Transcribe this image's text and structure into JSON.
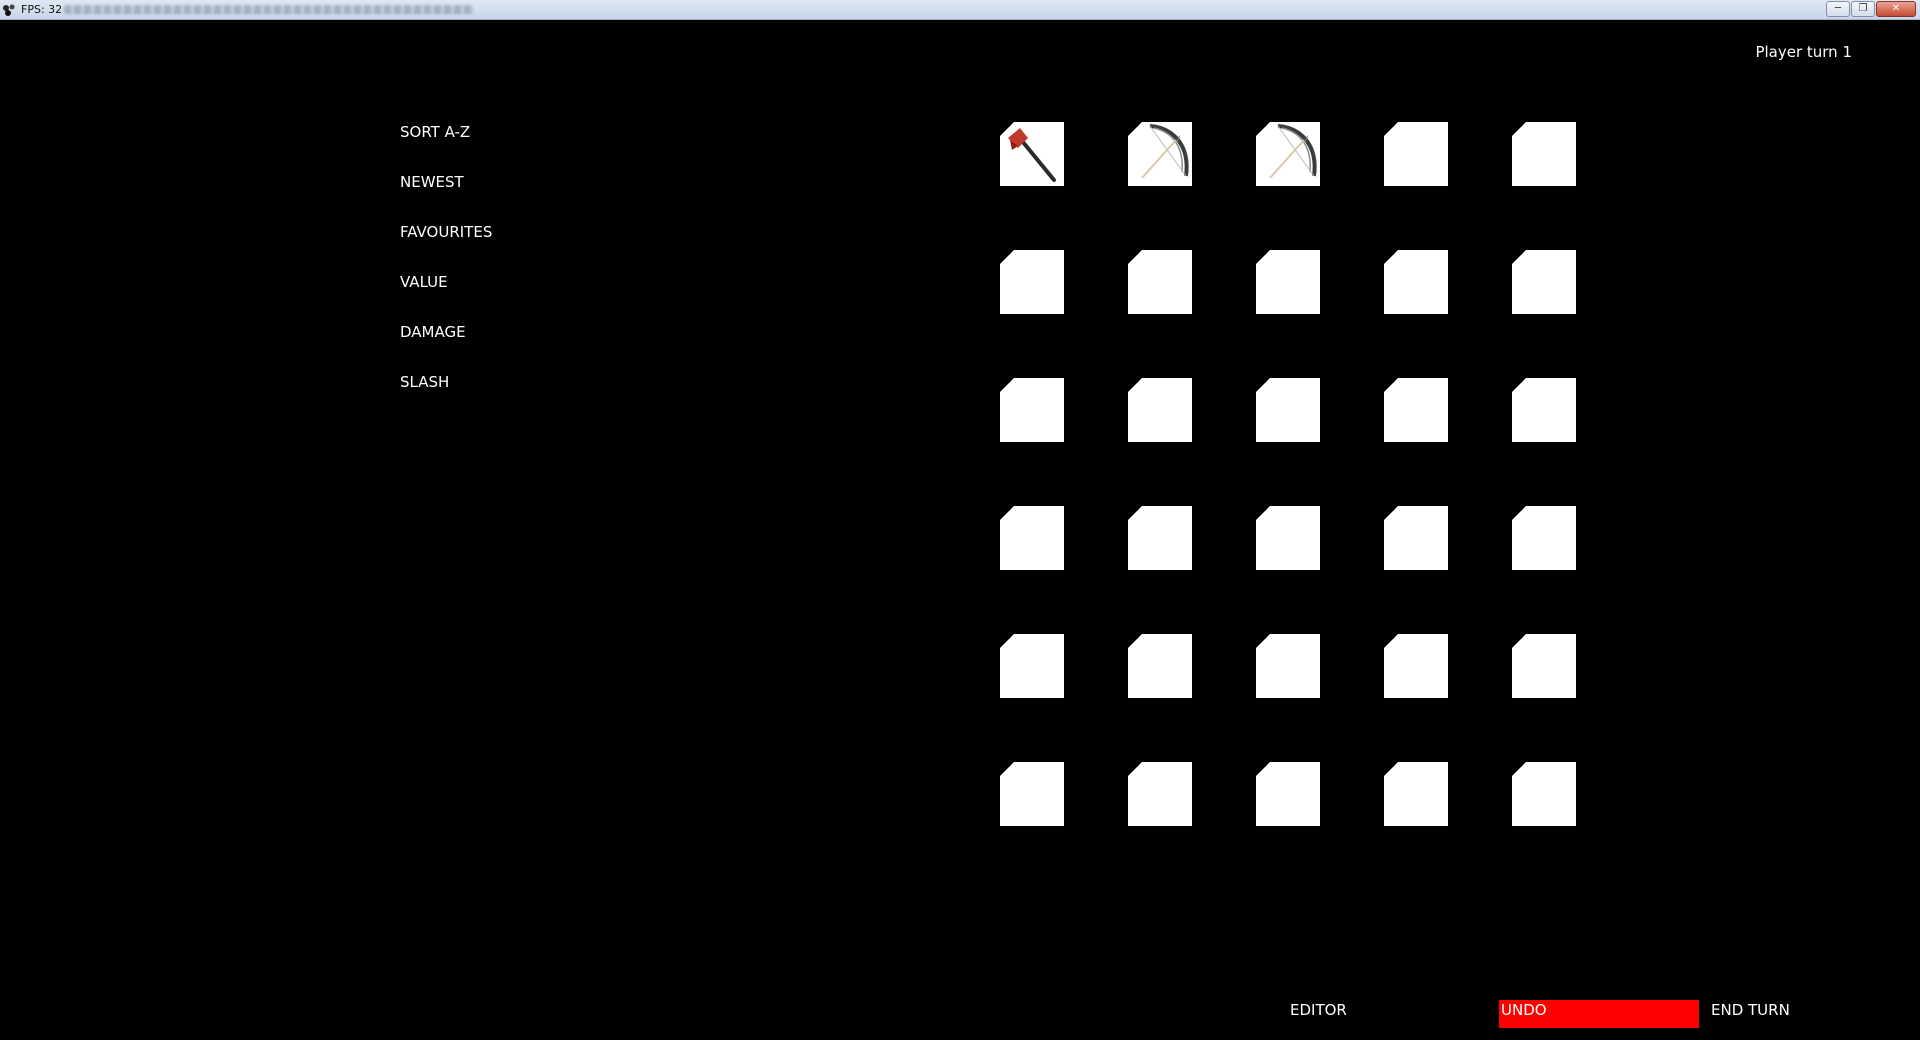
{
  "window": {
    "title": "FPS: 32",
    "controls": [
      "minimize",
      "maximize",
      "close"
    ]
  },
  "hud": {
    "player_turn": "Player turn 1"
  },
  "sort_menu": {
    "items": [
      "SORT A-Z",
      "NEWEST",
      "FAVOURITES",
      "VALUE",
      "DAMAGE",
      "SLASH"
    ]
  },
  "inventory": {
    "rows": 6,
    "columns": 5,
    "slots": [
      {
        "item": "axe-icon"
      },
      {
        "item": "bow-icon"
      },
      {
        "item": "bow-icon"
      },
      {
        "item": ""
      },
      {
        "item": ""
      },
      {
        "item": ""
      },
      {
        "item": ""
      },
      {
        "item": ""
      },
      {
        "item": ""
      },
      {
        "item": ""
      },
      {
        "item": ""
      },
      {
        "item": ""
      },
      {
        "item": ""
      },
      {
        "item": ""
      },
      {
        "item": ""
      },
      {
        "item": ""
      },
      {
        "item": ""
      },
      {
        "item": ""
      },
      {
        "item": ""
      },
      {
        "item": ""
      },
      {
        "item": ""
      },
      {
        "item": ""
      },
      {
        "item": ""
      },
      {
        "item": ""
      },
      {
        "item": ""
      },
      {
        "item": ""
      },
      {
        "item": ""
      },
      {
        "item": ""
      },
      {
        "item": ""
      },
      {
        "item": ""
      }
    ]
  },
  "buttons": {
    "editor": "EDITOR",
    "undo": "UNDO",
    "end_turn": "END TURN"
  },
  "colors": {
    "background": "#000000",
    "text": "#ffffff",
    "slot": "#ffffff",
    "undo_bg": "#ff0000"
  }
}
